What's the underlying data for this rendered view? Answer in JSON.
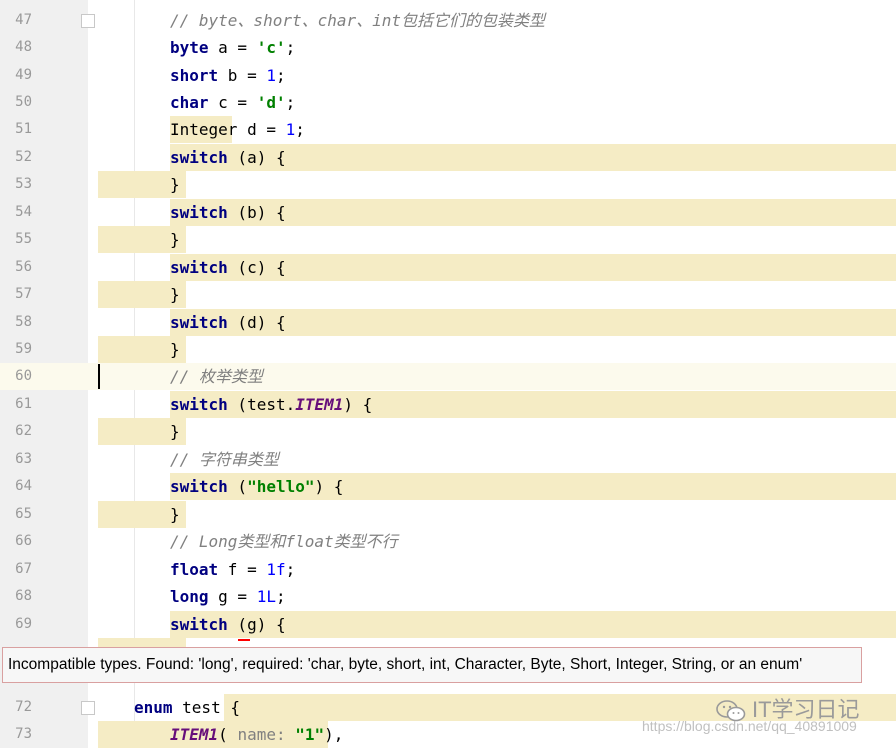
{
  "editor": {
    "lines": [
      {
        "n": "47"
      },
      {
        "n": "48"
      },
      {
        "n": "49"
      },
      {
        "n": "50"
      },
      {
        "n": "51"
      },
      {
        "n": "52"
      },
      {
        "n": "53"
      },
      {
        "n": "54"
      },
      {
        "n": "55"
      },
      {
        "n": "56"
      },
      {
        "n": "57"
      },
      {
        "n": "58"
      },
      {
        "n": "59"
      },
      {
        "n": "60"
      },
      {
        "n": "61"
      },
      {
        "n": "62"
      },
      {
        "n": "63"
      },
      {
        "n": "64"
      },
      {
        "n": "65"
      },
      {
        "n": "66"
      },
      {
        "n": "67"
      },
      {
        "n": "68"
      },
      {
        "n": "69"
      },
      {
        "n": "72"
      },
      {
        "n": "73"
      }
    ],
    "code": {
      "l47_comment": "// byte、short、char、int包括它们的包装类型",
      "l48_kw": "byte",
      "l48_rest1": " a = ",
      "l48_str": "'c'",
      "l48_rest2": ";",
      "l49_kw": "short",
      "l49_rest1": " b = ",
      "l49_num": "1",
      "l49_rest2": ";",
      "l50_kw": "char",
      "l50_rest1": " c = ",
      "l50_str": "'d'",
      "l50_rest2": ";",
      "l51_type": "Integer",
      "l51_rest1": " d = ",
      "l51_num": "1",
      "l51_rest2": ";",
      "switch_kw": "switch",
      "open_a": " (a) {",
      "open_b": " (b) {",
      "open_c": " (c) {",
      "open_d": " (d) {",
      "close": "}",
      "l60_comment": "// 枚举类型",
      "l61_open": " (test.",
      "l61_const": "ITEM1",
      "l61_close": ") {",
      "l63_comment": "// 字符串类型",
      "l64_open": " (",
      "l64_str": "\"hello\"",
      "l64_close": ") {",
      "l66_comment": "// Long类型和float类型不行",
      "l67_kw": "float",
      "l67_rest1": " f = ",
      "l67_num": "1f",
      "l67_rest2": ";",
      "l68_kw": "long",
      "l68_rest1": " g = ",
      "l68_num": "1L",
      "l68_rest2": ";",
      "l69_open": " (g) {",
      "l72_kw": "enum",
      "l72_rest": " test ",
      "l72_brace": "{",
      "l73_const": "ITEM1",
      "l73_paren": "( ",
      "l73_hint": "name:",
      "l73_str": " \"1\"",
      "l73_end": "),"
    }
  },
  "tooltip": {
    "message": "Incompatible types. Found: 'long', required: 'char, byte, short, int, Character, Byte, Short, Integer, String, or an enum'"
  },
  "watermark": {
    "url": "https://blog.csdn.net/qq_40891009",
    "brand": "IT学习日记",
    "icon": "wechat-icon"
  },
  "colors": {
    "keyword": "#000080",
    "string": "#008000",
    "number": "#0000ff",
    "comment": "#808080",
    "constant": "#660e7a",
    "highlight": "#f5ecc5",
    "gutter": "#f0f0f0"
  }
}
